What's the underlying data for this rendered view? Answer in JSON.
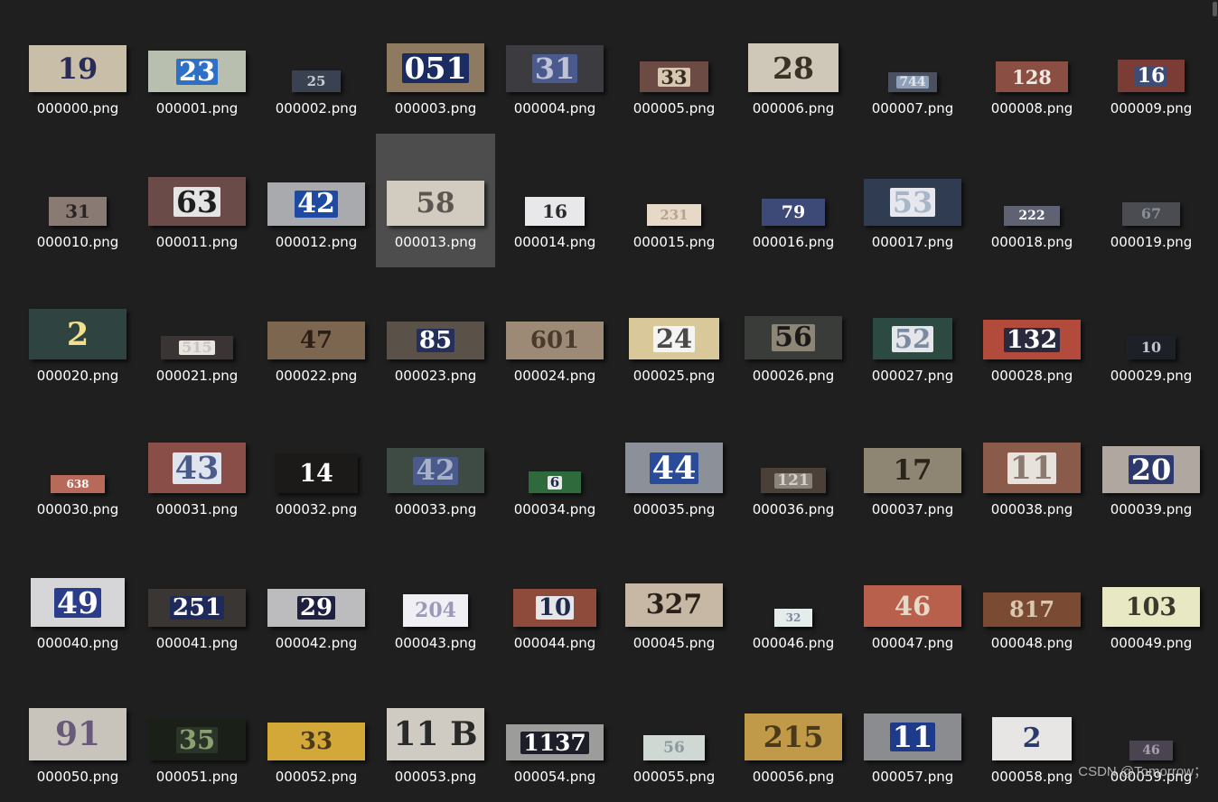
{
  "files": [
    {
      "name": "000000.png",
      "digits": "19",
      "w": 108,
      "h": 52,
      "bg": "#c9bfa8",
      "fg": "#2b2b5a",
      "sign": "",
      "selected": false
    },
    {
      "name": "000001.png",
      "digits": "23",
      "w": 108,
      "h": 46,
      "bg": "#b9bfae",
      "fg": "#ffffff",
      "sign": "#2e6fc7",
      "selected": false
    },
    {
      "name": "000002.png",
      "digits": "25",
      "w": 54,
      "h": 24,
      "bg": "#3a4150",
      "fg": "#c6cbd6",
      "sign": "",
      "selected": false
    },
    {
      "name": "000003.png",
      "digits": "051",
      "w": 108,
      "h": 54,
      "bg": "#8d7a60",
      "fg": "#ffffff",
      "sign": "#1b2c63",
      "selected": false
    },
    {
      "name": "000004.png",
      "digits": "31",
      "w": 108,
      "h": 52,
      "bg": "#3c3b3f",
      "fg": "#bfc3d6",
      "sign": "#4a5a8c",
      "selected": false
    },
    {
      "name": "000005.png",
      "digits": "33",
      "w": 76,
      "h": 34,
      "bg": "#6b4b44",
      "fg": "#3a2a20",
      "sign": "#d6c8b0",
      "selected": false
    },
    {
      "name": "000006.png",
      "digits": "28",
      "w": 100,
      "h": 54,
      "bg": "#cfc7b7",
      "fg": "#3a3226",
      "sign": "",
      "selected": false
    },
    {
      "name": "000007.png",
      "digits": "744",
      "w": 54,
      "h": 22,
      "bg": "#4a5060",
      "fg": "#e6e6e6",
      "sign": "#8da0bb",
      "selected": false
    },
    {
      "name": "000008.png",
      "digits": "128",
      "w": 80,
      "h": 34,
      "bg": "#8a4e42",
      "fg": "#f0e8e0",
      "sign": "",
      "selected": false
    },
    {
      "name": "000009.png",
      "digits": "16",
      "w": 74,
      "h": 36,
      "bg": "#7a3c34",
      "fg": "#ffffff",
      "sign": "#3e4c78",
      "selected": false
    },
    {
      "name": "000010.png",
      "digits": "31",
      "w": 64,
      "h": 32,
      "bg": "#8a7a74",
      "fg": "#2a2424",
      "sign": "",
      "selected": false
    },
    {
      "name": "000011.png",
      "digits": "63",
      "w": 108,
      "h": 54,
      "bg": "#6a4b47",
      "fg": "#1e1e1e",
      "sign": "#e4e4e4",
      "selected": false
    },
    {
      "name": "000012.png",
      "digits": "42",
      "w": 108,
      "h": 48,
      "bg": "#a9aaad",
      "fg": "#ffffff",
      "sign": "#1f4aa3",
      "selected": false
    },
    {
      "name": "000013.png",
      "digits": "58",
      "w": 108,
      "h": 50,
      "bg": "#d2cbc0",
      "fg": "#5c5650",
      "sign": "",
      "selected": true
    },
    {
      "name": "000014.png",
      "digits": "16",
      "w": 66,
      "h": 32,
      "bg": "#e8e8ea",
      "fg": "#2a2a2e",
      "sign": "",
      "selected": false
    },
    {
      "name": "000015.png",
      "digits": "231",
      "w": 60,
      "h": 24,
      "bg": "#e6d9c7",
      "fg": "#b8a48e",
      "sign": "",
      "selected": false
    },
    {
      "name": "000016.png",
      "digits": "79",
      "w": 70,
      "h": 30,
      "bg": "#3d4a78",
      "fg": "#ffffff",
      "sign": "",
      "selected": false
    },
    {
      "name": "000017.png",
      "digits": "53",
      "w": 108,
      "h": 52,
      "bg": "#2f3c52",
      "fg": "#a8b6c8",
      "sign": "#e6e8ee",
      "selected": false
    },
    {
      "name": "000018.png",
      "digits": "222",
      "w": 62,
      "h": 22,
      "bg": "#5e6272",
      "fg": "#ffffff",
      "sign": "",
      "selected": false
    },
    {
      "name": "000019.png",
      "digits": "67",
      "w": 64,
      "h": 26,
      "bg": "#4a4c52",
      "fg": "#8a8e96",
      "sign": "",
      "selected": false
    },
    {
      "name": "000020.png",
      "digits": "2",
      "w": 108,
      "h": 56,
      "bg": "#2f4440",
      "fg": "#f0e090",
      "sign": "",
      "selected": false
    },
    {
      "name": "000021.png",
      "digits": "515",
      "w": 80,
      "h": 26,
      "bg": "#3a3434",
      "fg": "#c8c2bc",
      "sign": "#e8e4e0",
      "selected": false
    },
    {
      "name": "000022.png",
      "digits": "47",
      "w": 108,
      "h": 42,
      "bg": "#7d6650",
      "fg": "#2a1e16",
      "sign": "",
      "selected": false
    },
    {
      "name": "000023.png",
      "digits": "85",
      "w": 108,
      "h": 42,
      "bg": "#5a5248",
      "fg": "#ffffff",
      "sign": "#24305a",
      "selected": false
    },
    {
      "name": "000024.png",
      "digits": "601",
      "w": 108,
      "h": 42,
      "bg": "#9c8a76",
      "fg": "#4a3a2c",
      "sign": "",
      "selected": false
    },
    {
      "name": "000025.png",
      "digits": "24",
      "w": 100,
      "h": 46,
      "bg": "#d8c89a",
      "fg": "#4a4a4a",
      "sign": "#f4f4f2",
      "selected": false
    },
    {
      "name": "000026.png",
      "digits": "56",
      "w": 108,
      "h": 48,
      "bg": "#3a3c3a",
      "fg": "#1a1a1a",
      "sign": "#8c8676",
      "selected": false
    },
    {
      "name": "000027.png",
      "digits": "52",
      "w": 88,
      "h": 46,
      "bg": "#2c4a42",
      "fg": "#7a8aa0",
      "sign": "#e4e6ea",
      "selected": false
    },
    {
      "name": "000028.png",
      "digits": "132",
      "w": 108,
      "h": 44,
      "bg": "#b24b3c",
      "fg": "#ffffff",
      "sign": "#2a2a3e",
      "selected": false
    },
    {
      "name": "000029.png",
      "digits": "10",
      "w": 54,
      "h": 26,
      "bg": "#1e2028",
      "fg": "#c0c4cc",
      "sign": "",
      "selected": false
    },
    {
      "name": "000030.png",
      "digits": "638",
      "w": 60,
      "h": 20,
      "bg": "#b86a5a",
      "fg": "#ffffff",
      "sign": "",
      "selected": false
    },
    {
      "name": "000031.png",
      "digits": "43",
      "w": 108,
      "h": 56,
      "bg": "#8a4e48",
      "fg": "#4a5a8a",
      "sign": "#dfe4ee",
      "selected": false
    },
    {
      "name": "000032.png",
      "digits": "14",
      "w": 92,
      "h": 44,
      "bg": "#1c1a18",
      "fg": "#ffffff",
      "sign": "",
      "selected": false
    },
    {
      "name": "000033.png",
      "digits": "42",
      "w": 108,
      "h": 50,
      "bg": "#3e4a44",
      "fg": "#a8b0c8",
      "sign": "#4a5a8c",
      "selected": false
    },
    {
      "name": "000034.png",
      "digits": "6",
      "w": 58,
      "h": 24,
      "bg": "#2e6a3c",
      "fg": "#1e2a3e",
      "sign": "#e8e8ee",
      "selected": false
    },
    {
      "name": "000035.png",
      "digits": "44",
      "w": 108,
      "h": 56,
      "bg": "#8c9098",
      "fg": "#ffffff",
      "sign": "#2a4a9a",
      "selected": false
    },
    {
      "name": "000036.png",
      "digits": "121",
      "w": 72,
      "h": 28,
      "bg": "#4a4038",
      "fg": "#d8d0c8",
      "sign": "#8a847c",
      "selected": false
    },
    {
      "name": "000037.png",
      "digits": "17",
      "w": 108,
      "h": 50,
      "bg": "#8e8672",
      "fg": "#2a241a",
      "sign": "",
      "selected": false
    },
    {
      "name": "000038.png",
      "digits": "11",
      "w": 108,
      "h": 56,
      "bg": "#8a5a4a",
      "fg": "#8a7a70",
      "sign": "#e8e2dc",
      "selected": false
    },
    {
      "name": "000039.png",
      "digits": "20",
      "w": 108,
      "h": 52,
      "bg": "#b0a8a0",
      "fg": "#ffffff",
      "sign": "#2e3a6e",
      "selected": false
    },
    {
      "name": "000040.png",
      "digits": "49",
      "w": 104,
      "h": 54,
      "bg": "#d6d6d8",
      "fg": "#ffffff",
      "sign": "#2a3c8a",
      "selected": false
    },
    {
      "name": "000041.png",
      "digits": "251",
      "w": 108,
      "h": 42,
      "bg": "#3a3634",
      "fg": "#ffffff",
      "sign": "#1e2a5a",
      "selected": false
    },
    {
      "name": "000042.png",
      "digits": "29",
      "w": 108,
      "h": 42,
      "bg": "#bcbcbe",
      "fg": "#ffffff",
      "sign": "#1e2040",
      "selected": false
    },
    {
      "name": "000043.png",
      "digits": "204",
      "w": 72,
      "h": 36,
      "bg": "#f0f0f4",
      "fg": "#9a9ab8",
      "sign": "",
      "selected": false
    },
    {
      "name": "000044.png",
      "digits": "10",
      "w": 92,
      "h": 42,
      "bg": "#8e4a3a",
      "fg": "#1e2a4a",
      "sign": "#e6e6ea",
      "selected": false
    },
    {
      "name": "000045.png",
      "digits": "327",
      "w": 108,
      "h": 48,
      "bg": "#c6b8a4",
      "fg": "#2a221a",
      "sign": "",
      "selected": false
    },
    {
      "name": "000046.png",
      "digits": "32",
      "w": 42,
      "h": 20,
      "bg": "#e4ecec",
      "fg": "#7a8a9a",
      "sign": "",
      "selected": false
    },
    {
      "name": "000047.png",
      "digits": "46",
      "w": 108,
      "h": 46,
      "bg": "#b8604c",
      "fg": "#e8d8c8",
      "sign": "",
      "selected": false
    },
    {
      "name": "000048.png",
      "digits": "817",
      "w": 108,
      "h": 38,
      "bg": "#7a4a32",
      "fg": "#d8c8b0",
      "sign": "",
      "selected": false
    },
    {
      "name": "000049.png",
      "digits": "103",
      "w": 108,
      "h": 44,
      "bg": "#e8e8c4",
      "fg": "#3a3a2a",
      "sign": "",
      "selected": false
    },
    {
      "name": "000050.png",
      "digits": "91",
      "w": 108,
      "h": 58,
      "bg": "#c8c4bc",
      "fg": "#6a5a7a",
      "sign": "",
      "selected": false
    },
    {
      "name": "000051.png",
      "digits": "35",
      "w": 108,
      "h": 46,
      "bg": "#1a2018",
      "fg": "#8aa070",
      "sign": "#2a3428",
      "selected": false
    },
    {
      "name": "000052.png",
      "digits": "33",
      "w": 108,
      "h": 42,
      "bg": "#d4a838",
      "fg": "#4a3a1a",
      "sign": "",
      "selected": false
    },
    {
      "name": "000053.png",
      "digits": "11 B",
      "w": 108,
      "h": 58,
      "bg": "#cfcac2",
      "fg": "#2a2a2a",
      "sign": "",
      "selected": false
    },
    {
      "name": "000054.png",
      "digits": "1137",
      "w": 108,
      "h": 40,
      "bg": "#9c9c9a",
      "fg": "#ffffff",
      "sign": "#1e1e2a",
      "selected": false
    },
    {
      "name": "000055.png",
      "digits": "56",
      "w": 68,
      "h": 28,
      "bg": "#d0d8d4",
      "fg": "#8a9aa0",
      "sign": "",
      "selected": false
    },
    {
      "name": "000056.png",
      "digits": "215",
      "w": 108,
      "h": 52,
      "bg": "#c09a48",
      "fg": "#4a3a1a",
      "sign": "",
      "selected": false
    },
    {
      "name": "000057.png",
      "digits": "11",
      "w": 108,
      "h": 52,
      "bg": "#8a8c90",
      "fg": "#ffffff",
      "sign": "#1e3a8a",
      "selected": false
    },
    {
      "name": "000058.png",
      "digits": "2",
      "w": 88,
      "h": 48,
      "bg": "#e8e6e4",
      "fg": "#2a3a6a",
      "sign": "",
      "selected": false
    },
    {
      "name": "000059.png",
      "digits": "46",
      "w": 48,
      "h": 22,
      "bg": "#4a4450",
      "fg": "#a8a0b0",
      "sign": "",
      "selected": false
    }
  ],
  "watermark": "CSDN @Tomorrow；"
}
